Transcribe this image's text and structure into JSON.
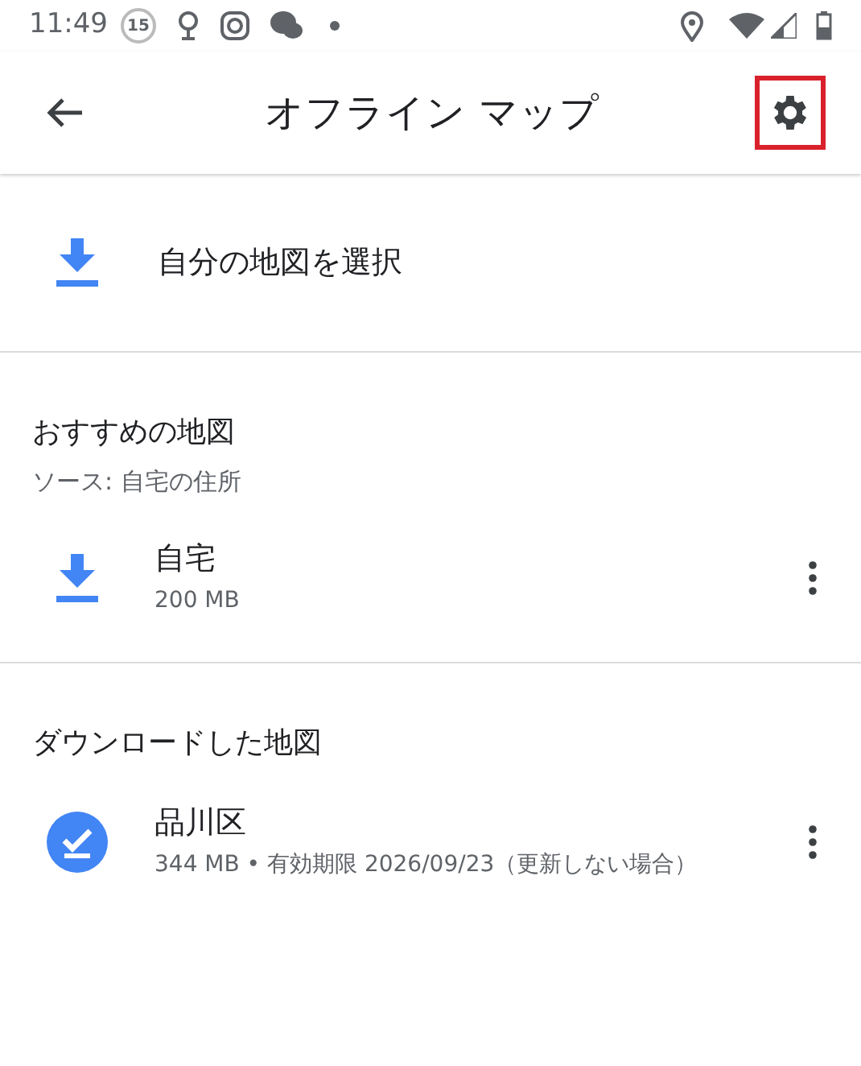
{
  "status_bar": {
    "time": "11:49",
    "badge": "15"
  },
  "app_bar": {
    "title": "オフライン マップ",
    "settings_highlighted": true
  },
  "select_action": {
    "label": "自分の地図を選択"
  },
  "sections": [
    {
      "title": "おすすめの地図",
      "subtitle": "ソース: 自宅の住所",
      "items": [
        {
          "kind": "download",
          "name": "自宅",
          "detail": "200 MB"
        }
      ]
    },
    {
      "title": "ダウンロードした地図",
      "items": [
        {
          "kind": "downloaded",
          "name": "品川区",
          "detail": "344 MB • 有効期限 2026/09/23（更新しない場合）"
        }
      ]
    }
  ]
}
